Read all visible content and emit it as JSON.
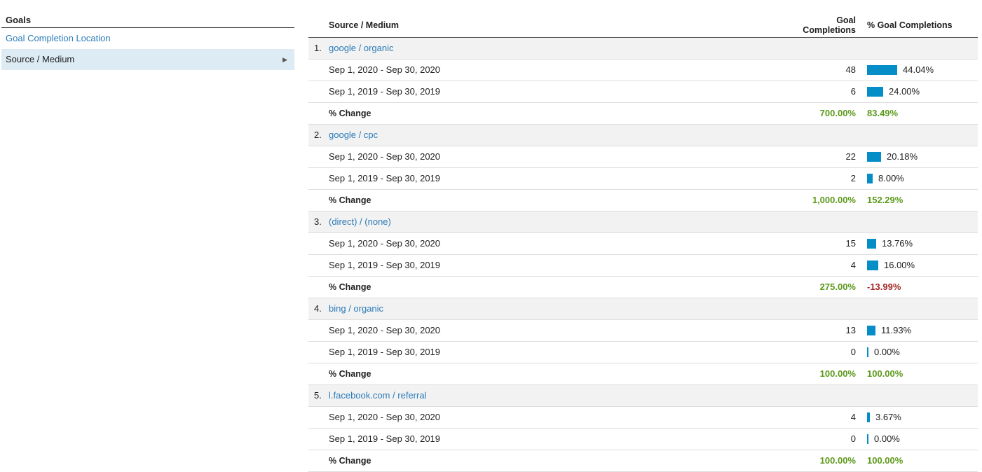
{
  "sidebar": {
    "header": "Goals",
    "items": [
      {
        "label": "Goal Completion Location"
      },
      {
        "label": "Source / Medium"
      }
    ]
  },
  "table": {
    "headers": {
      "source_medium": "Source / Medium",
      "goal_completions_line1": "Goal",
      "goal_completions_line2": "Completions",
      "pct_goal_completions": "% Goal Completions"
    },
    "colors": {
      "bar": "#058dc7",
      "positive": "#5c9a1b",
      "negative": "#a52a2a"
    },
    "groups": [
      {
        "index": "1.",
        "name": "google / organic",
        "rows": [
          {
            "label": "Sep 1, 2020 - Sep 30, 2020",
            "value": "48",
            "pct": "44.04%",
            "share": 0.4404
          },
          {
            "label": "Sep 1, 2019 - Sep 30, 2019",
            "value": "6",
            "pct": "24.00%",
            "share": 0.24
          }
        ],
        "change": {
          "label": "% Change",
          "value": "700.00%",
          "pct": "83.49%",
          "value_sign": "pos",
          "pct_sign": "pos"
        }
      },
      {
        "index": "2.",
        "name": "google / cpc",
        "rows": [
          {
            "label": "Sep 1, 2020 - Sep 30, 2020",
            "value": "22",
            "pct": "20.18%",
            "share": 0.2018
          },
          {
            "label": "Sep 1, 2019 - Sep 30, 2019",
            "value": "2",
            "pct": "8.00%",
            "share": 0.08
          }
        ],
        "change": {
          "label": "% Change",
          "value": "1,000.00%",
          "pct": "152.29%",
          "value_sign": "pos",
          "pct_sign": "pos"
        }
      },
      {
        "index": "3.",
        "name": "(direct) / (none)",
        "rows": [
          {
            "label": "Sep 1, 2020 - Sep 30, 2020",
            "value": "15",
            "pct": "13.76%",
            "share": 0.1376
          },
          {
            "label": "Sep 1, 2019 - Sep 30, 2019",
            "value": "4",
            "pct": "16.00%",
            "share": 0.16
          }
        ],
        "change": {
          "label": "% Change",
          "value": "275.00%",
          "pct": "-13.99%",
          "value_sign": "pos",
          "pct_sign": "neg"
        }
      },
      {
        "index": "4.",
        "name": "bing / organic",
        "rows": [
          {
            "label": "Sep 1, 2020 - Sep 30, 2020",
            "value": "13",
            "pct": "11.93%",
            "share": 0.1193
          },
          {
            "label": "Sep 1, 2019 - Sep 30, 2019",
            "value": "0",
            "pct": "0.00%",
            "share": 0.0
          }
        ],
        "change": {
          "label": "% Change",
          "value": "100.00%",
          "pct": "100.00%",
          "value_sign": "pos",
          "pct_sign": "pos"
        }
      },
      {
        "index": "5.",
        "name": "l.facebook.com / referral",
        "rows": [
          {
            "label": "Sep 1, 2020 - Sep 30, 2020",
            "value": "4",
            "pct": "3.67%",
            "share": 0.0367
          },
          {
            "label": "Sep 1, 2019 - Sep 30, 2019",
            "value": "0",
            "pct": "0.00%",
            "share": 0.0
          }
        ],
        "change": {
          "label": "% Change",
          "value": "100.00%",
          "pct": "100.00%",
          "value_sign": "pos",
          "pct_sign": "pos"
        }
      }
    ]
  }
}
